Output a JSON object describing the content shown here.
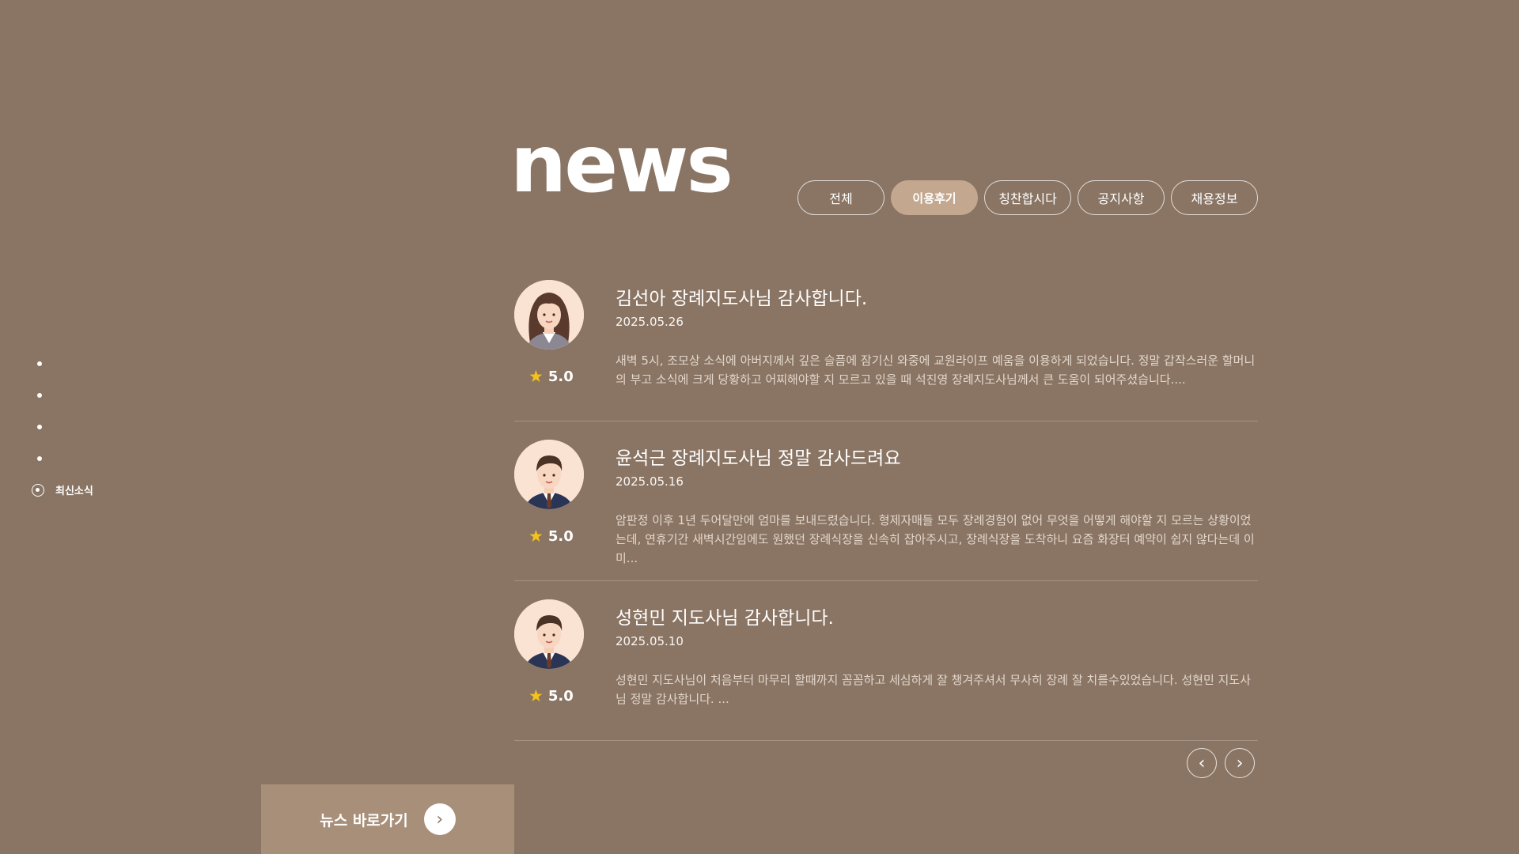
{
  "side_nav": {
    "active_label": "최신소식"
  },
  "header": {
    "title": "news"
  },
  "tabs": [
    {
      "label": "전체",
      "active": false
    },
    {
      "label": "이용후기",
      "active": true
    },
    {
      "label": "칭찬합시다",
      "active": false
    },
    {
      "label": "공지사항",
      "active": false
    },
    {
      "label": "채용정보",
      "active": false
    }
  ],
  "reviews": [
    {
      "title": "김선아 장례지도사님 감사합니다.",
      "date": "2025.05.26",
      "rating": "5.0",
      "avatar": "female-avatar-icon",
      "excerpt": "새벽 5시, 조모상 소식에 아버지께서 깊은 슬픔에 잠기신 와중에 교원라이프 예움을 이용하게 되었습니다. 정말 갑작스러운 할머니의 부고 소식에 크게 당황하고 어찌해야할 지 모르고 있을 때 석진영 장례지도사님께서 큰 도움이 되어주셨습니다...."
    },
    {
      "title": "윤석근 장례지도사님 정말 감사드려요",
      "date": "2025.05.16",
      "rating": "5.0",
      "avatar": "male-avatar-icon",
      "excerpt": "암판정 이후 1년 두어달만에 엄마를 보내드렸습니다. 형제자매들 모두 장례경험이 없어 무엇을 어떻게 해야할 지 모르는 상황이었는데, 연휴기간 새벽시간임에도 원했던 장례식장을 신속히 잡아주시고, 장례식장을 도착하니 요즘 화장터 예약이 쉽지 않다는데 이미..."
    },
    {
      "title": "성현민 지도사님 감사합니다.",
      "date": "2025.05.10",
      "rating": "5.0",
      "avatar": "male-avatar-icon",
      "excerpt": "성현민 지도사님이 처음부터 마무리 할때까지 꼼꼼하고 세심하게 잘 챙겨주셔서 무사히 장례 잘 치를수있었습니다. 성현민 지도사님 정말 감사합니다. ..."
    }
  ],
  "pager": {
    "prev": "‹",
    "next": "›"
  },
  "news_link": {
    "label": "뉴스 바로가기",
    "arrow": "›"
  },
  "colors": {
    "background": "#8a7564",
    "accent": "#c3a88f",
    "star": "#f5c21b",
    "bar": "#a88f79"
  }
}
